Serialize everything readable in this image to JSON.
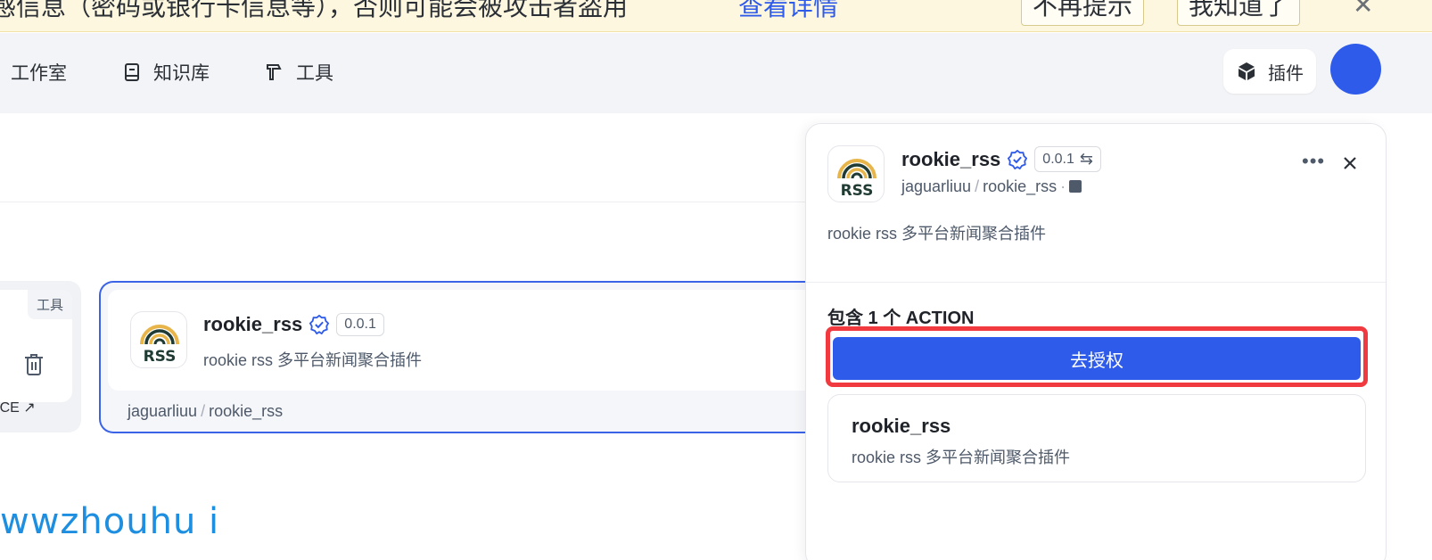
{
  "banner": {
    "text": "感信息（密码或银行卡信息等），否则可能会被攻击者盗用",
    "link": "查看详情",
    "no_remind": "不再提示",
    "got_it": "我知道了"
  },
  "nav": {
    "items": [
      {
        "label": "工作室",
        "icon": "studio-icon"
      },
      {
        "label": "知识库",
        "icon": "book-icon"
      },
      {
        "label": "工具",
        "icon": "tool-icon"
      }
    ],
    "plugin_label": "插件"
  },
  "left_card": {
    "tag": "工具",
    "link": "LACE ↗"
  },
  "selected_plugin": {
    "name": "rookie_rss",
    "version": "0.0.1",
    "description": "rookie rss 多平台新闻聚合插件",
    "author": "jaguarliuu",
    "repo": "rookie_rss"
  },
  "watermark": "wwzhouhu i",
  "panel": {
    "name": "rookie_rss",
    "version": "0.0.1",
    "author": "jaguarliuu",
    "repo": "rookie_rss",
    "description": "rookie rss 多平台新闻聚合插件",
    "actions_title": "包含 1 个 ACTION",
    "authorize_label": "去授权",
    "action": {
      "name": "rookie_rss",
      "description": "rookie rss 多平台新闻聚合插件"
    }
  },
  "colors": {
    "accent": "#2f5bea",
    "highlight": "#f03a3f",
    "banner_bg": "#fdf7df"
  }
}
